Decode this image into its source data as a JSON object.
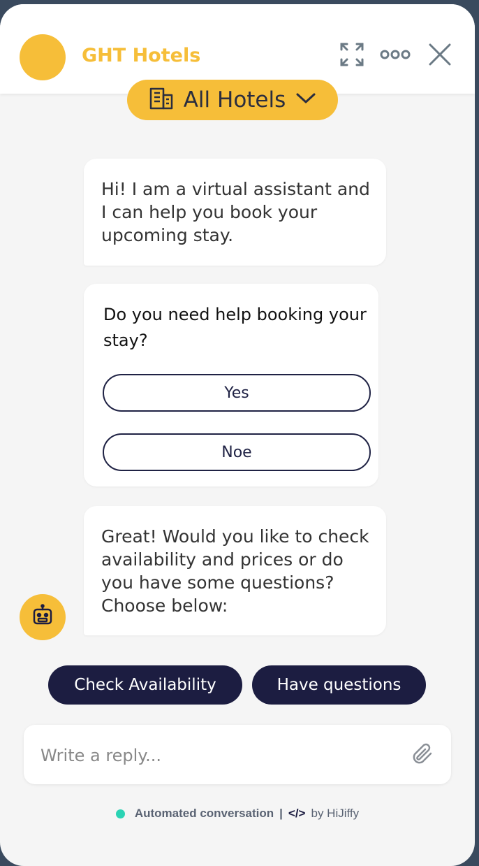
{
  "header": {
    "brand": "GHT Hotels",
    "expand_icon": "expand-icon",
    "more_icon": "more-icon",
    "close_icon": "close-icon"
  },
  "hotel_selector": {
    "label": "All Hotels",
    "icon": "building-icon"
  },
  "messages": {
    "greeting": "Hi! I am a virtual assistant and I can help you book your upcoming stay.",
    "question": {
      "title": "Do you need help booking your stay?",
      "options": [
        "Yes",
        "Noe"
      ]
    },
    "followup": "Great! Would you like to check availability and prices or do you have some questions? Choose below:"
  },
  "quick_replies": [
    "Check Availability",
    "Have questions"
  ],
  "composer": {
    "placeholder": "Write a reply...",
    "attach_icon": "paperclip-icon"
  },
  "footer": {
    "status": "Automated conversation",
    "separator": "|",
    "code_symbol": "</>",
    "by": "by HiJiffy"
  },
  "colors": {
    "brand_yellow": "#f6be39",
    "navy": "#1c1d41",
    "status_green": "#2bd3b4"
  }
}
